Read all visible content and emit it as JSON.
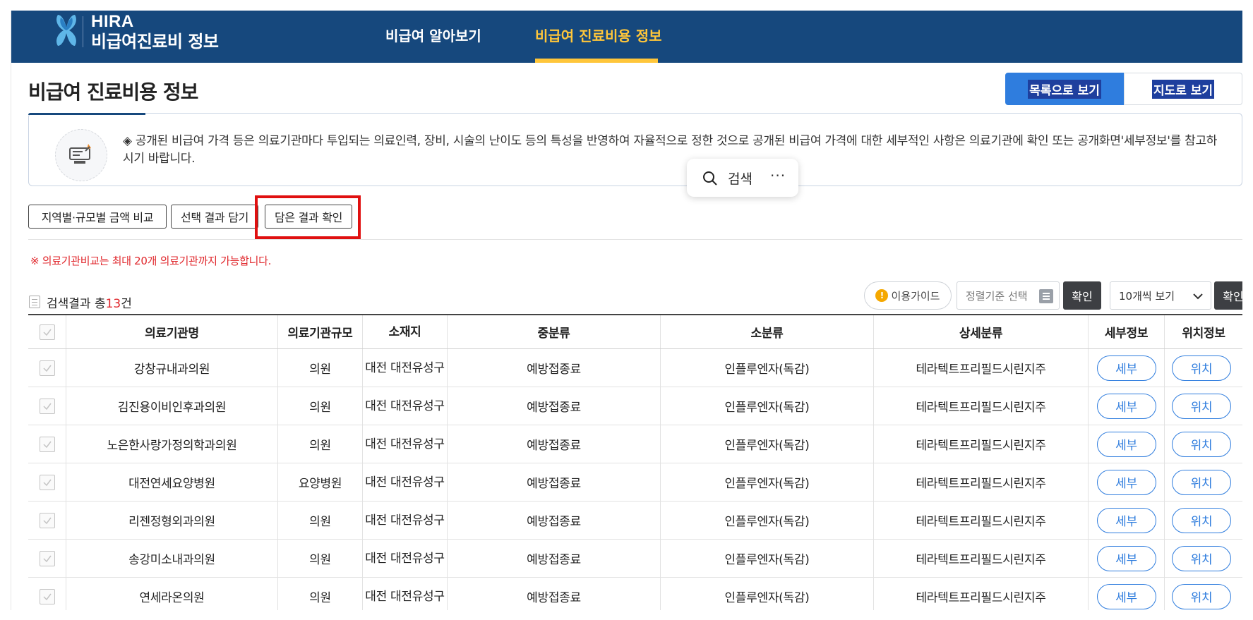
{
  "header": {
    "logo_hira": "HIRA",
    "logo_sub": "비급여진료비 정보",
    "nav": [
      "비급여 알아보기",
      "비급여 진료비용 정보"
    ],
    "colors": {
      "bar": "#16487d",
      "active": "#ffc63a"
    }
  },
  "page": {
    "title": "비급여 진료비용 정보",
    "view_list": "목록으로 보기",
    "view_map": "지도로 보기"
  },
  "notice": {
    "text": "◈ 공개된 비급여 가격 등은 의료기관마다 투입되는 의료인력, 장비, 시술의 난이도 등의 특성을 반영하여 자율적으로 정한 것으로 공개된 비급여 가격에 대한 세부적인 사항은 의료기관에 확인 또는 공개화면'세부정보'를 참고하시기 바랍니다."
  },
  "popup": {
    "label": "검색",
    "more": "···"
  },
  "actions": {
    "compare": "지역별·규모별 금액 비교",
    "save_selected": "선택 결과 담기",
    "check_saved": "담은 결과 확인"
  },
  "warning": "※ 의료기관비교는 최대 20개 의료기관까지 가능합니다.",
  "results": {
    "prefix": "검색결과 총",
    "count": "13",
    "suffix": "건"
  },
  "controls": {
    "guide": "이용가이드",
    "sort_placeholder": "정렬기준 선택",
    "confirm": "확인",
    "per_page": "10개씩 보기"
  },
  "table": {
    "headers": [
      "의료기관명",
      "의료기관규모",
      "소재지",
      "중분류",
      "소분류",
      "상세분류",
      "세부정보",
      "위치정보"
    ],
    "detail_label": "세부",
    "location_label": "위치",
    "rows": [
      {
        "name": "강창규내과의원",
        "size": "의원",
        "loc": "대전 대전유성구",
        "mid": "예방접종료",
        "small": "인플루엔자(독감)",
        "detail": "테라텍트프리필드시린지주"
      },
      {
        "name": "김진용이비인후과의원",
        "size": "의원",
        "loc": "대전 대전유성구",
        "mid": "예방접종료",
        "small": "인플루엔자(독감)",
        "detail": "테라텍트프리필드시린지주"
      },
      {
        "name": "노은한사랑가정의학과의원",
        "size": "의원",
        "loc": "대전 대전유성구",
        "mid": "예방접종료",
        "small": "인플루엔자(독감)",
        "detail": "테라텍트프리필드시린지주"
      },
      {
        "name": "대전연세요양병원",
        "size": "요양병원",
        "loc": "대전 대전유성구",
        "mid": "예방접종료",
        "small": "인플루엔자(독감)",
        "detail": "테라텍트프리필드시린지주"
      },
      {
        "name": "리젠정형외과의원",
        "size": "의원",
        "loc": "대전 대전유성구",
        "mid": "예방접종료",
        "small": "인플루엔자(독감)",
        "detail": "테라텍트프리필드시린지주"
      },
      {
        "name": "송강미소내과의원",
        "size": "의원",
        "loc": "대전 대전유성구",
        "mid": "예방접종료",
        "small": "인플루엔자(독감)",
        "detail": "테라텍트프리필드시린지주"
      },
      {
        "name": "연세라온의원",
        "size": "의원",
        "loc": "대전 대전유성구",
        "mid": "예방접종료",
        "small": "인플루엔자(독감)",
        "detail": "테라텍트프리필드시린지주"
      }
    ]
  },
  "icons": [
    "hira-logo-icon",
    "notice-monitor-icon",
    "search-icon",
    "more-icon",
    "info-icon",
    "list-icon",
    "chevron-down-icon",
    "checkbox-icon"
  ]
}
